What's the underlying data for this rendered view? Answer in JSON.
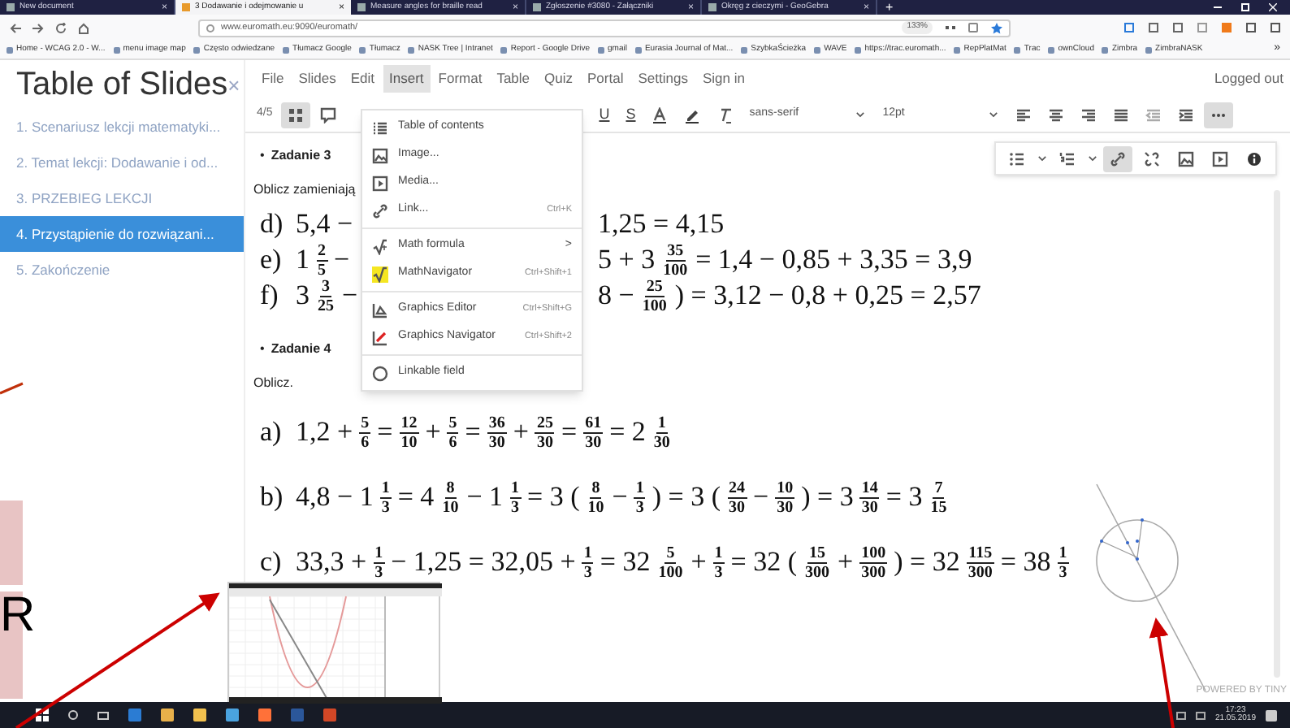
{
  "browser": {
    "tabs": [
      {
        "title": "New document",
        "selected": false,
        "close": "×"
      },
      {
        "title": "3 Dodawanie i odejmowanie u",
        "selected": true,
        "close": "×"
      },
      {
        "title": "Measure angles for braille read",
        "selected": false,
        "close": "×"
      },
      {
        "title": "Zgłoszenie #3080 - Załączniki",
        "selected": false,
        "close": "×"
      },
      {
        "title": "Okręg z cieczymi - GeoGebra",
        "selected": false,
        "close": "×"
      }
    ],
    "new_tab": "+",
    "url": "www.euromath.eu:9090/euromath/",
    "zoom": "133%",
    "bookmarks": [
      "Home - WCAG 2.0 - W...",
      "menu image map",
      "Często odwiedzane",
      "Tłumacz Google",
      "Tłumacz",
      "NASK Tree | Intranet",
      "Report - Google Drive",
      "gmail",
      "Eurasia Journal of Mat...",
      "SzybkaŚcieżka",
      "WAVE",
      "https://trac.euromath...",
      "RepPlatMat",
      "Trac",
      "ownCloud",
      "Zimbra",
      "ZimbraNASK"
    ],
    "more": "»"
  },
  "sidebar": {
    "title": "Table of Slides",
    "close": "×",
    "slides": [
      {
        "label": "1. Scenariusz lekcji matematyki...",
        "selected": false
      },
      {
        "label": "2. Temat lekcji: Dodawanie i od...",
        "selected": false
      },
      {
        "label": "3. PRZEBIEG LEKCJI",
        "selected": false
      },
      {
        "label": "4.  Przystąpienie do rozwiązani...",
        "selected": true
      },
      {
        "label": "5. Zakończenie",
        "selected": false
      }
    ]
  },
  "menu": [
    {
      "label": "File",
      "selected": false
    },
    {
      "label": "Slides",
      "selected": false
    },
    {
      "label": "Edit",
      "selected": false
    },
    {
      "label": "Insert",
      "selected": true
    },
    {
      "label": "Format",
      "selected": false
    },
    {
      "label": "Table",
      "selected": false
    },
    {
      "label": "Quiz",
      "selected": false
    },
    {
      "label": "Portal",
      "selected": false
    },
    {
      "label": "Settings",
      "selected": false
    },
    {
      "label": "Sign in",
      "selected": false
    }
  ],
  "login_status": "Logged out",
  "toolbar": {
    "page": "4/5",
    "font": "sans-serif",
    "size": "12pt",
    "buttons": [
      {
        "kind": "grid",
        "pressed": true
      },
      {
        "kind": "comment",
        "pressed": false
      },
      {
        "kind": "gap"
      },
      {
        "kind": "glyph",
        "text": "U",
        "pressed": false
      },
      {
        "kind": "glyph",
        "text": "S",
        "pressed": false
      },
      {
        "kind": "textcolor",
        "pressed": false
      },
      {
        "kind": "highlight",
        "pressed": false
      },
      {
        "kind": "clear",
        "pressed": false
      },
      {
        "kind": "selects"
      },
      {
        "kind": "align-left",
        "pressed": false
      },
      {
        "kind": "align-center",
        "pressed": false
      },
      {
        "kind": "align-right",
        "pressed": false
      },
      {
        "kind": "justify",
        "pressed": false
      },
      {
        "kind": "outdent",
        "pressed": false
      },
      {
        "kind": "indent",
        "pressed": false
      },
      {
        "kind": "more",
        "pressed": true
      }
    ]
  },
  "more_toolbar": [
    {
      "kind": "bullets",
      "pressed": false
    },
    {
      "kind": "numbers",
      "pressed": false
    },
    {
      "kind": "link",
      "pressed": true
    },
    {
      "kind": "unlink",
      "pressed": false
    },
    {
      "kind": "image",
      "pressed": false
    },
    {
      "kind": "media",
      "pressed": false
    },
    {
      "kind": "info",
      "pressed": false
    }
  ],
  "insert_menu": [
    {
      "kind": "item",
      "label": "Table of contents"
    },
    {
      "kind": "item",
      "label": "Image..."
    },
    {
      "kind": "item",
      "label": "Media..."
    },
    {
      "kind": "item",
      "label": "Link...",
      "shortcut": "Ctrl+K"
    },
    {
      "kind": "separator"
    },
    {
      "kind": "item",
      "label": "Math formula",
      "submenu": ">"
    },
    {
      "kind": "item",
      "label": "MathNavigator",
      "shortcut": "Ctrl+Shift+1"
    },
    {
      "kind": "separator"
    },
    {
      "kind": "item",
      "label": "Graphics Editor",
      "shortcut": "Ctrl+Shift+G"
    },
    {
      "kind": "item",
      "label": "Graphics Navigator",
      "shortcut": "Ctrl+Shift+2"
    },
    {
      "kind": "separator"
    },
    {
      "kind": "item",
      "label": "Linkable field"
    }
  ],
  "content": [
    {
      "kind": "bullet",
      "marker": "•",
      "text": "Zadanie 3"
    },
    {
      "kind": "para",
      "text": "Oblicz zamieniają"
    },
    {
      "kind": "formula",
      "label": "d)",
      "segments": [
        [
          "5,4 −"
        ],
        [
          "1,25 = 4,15"
        ]
      ]
    },
    {
      "kind": "formula",
      "label": "e)",
      "segments": [
        [
          "1",
          {
            "n": "2",
            "d": "5"
          },
          "−"
        ],
        [
          "5 + 3",
          {
            "n": "35",
            "d": "100"
          },
          "= 1,4 − 0,85 + 3,35 = 3,9"
        ]
      ]
    },
    {
      "kind": "formula",
      "label": "f)",
      "segments": [
        [
          "3",
          {
            "n": "3",
            "d": "25"
          },
          "−"
        ],
        [
          "8 −",
          {
            "n": "25",
            "d": "100"
          },
          ") = 3,12 − 0,8 + 0,25 = 2,57"
        ]
      ]
    },
    {
      "kind": "bullet",
      "marker": "•",
      "text": "Zadanie 4"
    },
    {
      "kind": "para",
      "text": "Oblicz."
    },
    {
      "kind": "formula",
      "label": "a)",
      "segments": [
        [
          "1,2 +",
          {
            "n": "5",
            "d": "6"
          },
          "=",
          {
            "n": "12",
            "d": "10"
          },
          "+",
          {
            "n": "5",
            "d": "6"
          },
          "=",
          {
            "n": "36",
            "d": "30"
          },
          "+",
          {
            "n": "25",
            "d": "30"
          },
          "=",
          {
            "n": "61",
            "d": "30"
          },
          "= 2",
          {
            "n": "1",
            "d": "30"
          }
        ]
      ]
    },
    {
      "kind": "formula",
      "label": "b)",
      "segments": [
        [
          "4,8 − 1",
          {
            "n": "1",
            "d": "3"
          },
          "= 4",
          {
            "n": "8",
            "d": "10"
          },
          "− 1",
          {
            "n": "1",
            "d": "3"
          },
          "= 3 (",
          {
            "n": "8",
            "d": "10"
          },
          "−",
          {
            "n": "1",
            "d": "3"
          },
          ") = 3 (",
          {
            "n": "24",
            "d": "30"
          },
          "−",
          {
            "n": "10",
            "d": "30"
          },
          ") = 3",
          {
            "n": "14",
            "d": "30"
          },
          "= 3",
          {
            "n": "7",
            "d": "15"
          }
        ]
      ]
    },
    {
      "kind": "formula",
      "label": "c)",
      "segments": [
        [
          "33,3 +",
          {
            "n": "1",
            "d": "3"
          },
          "− 1,25 = 32,05 +",
          {
            "n": "1",
            "d": "3"
          },
          "= 32",
          {
            "n": "5",
            "d": "100"
          },
          "+",
          {
            "n": "1",
            "d": "3"
          },
          "= 32 (",
          {
            "n": "15",
            "d": "300"
          },
          "+",
          {
            "n": "100",
            "d": "300"
          },
          ") = 32",
          {
            "n": "115",
            "d": "300"
          },
          "= 38",
          {
            "n": "1",
            "d": "3"
          }
        ]
      ]
    }
  ],
  "overlay": {
    "letter": "R",
    "credit": "POWERED BY TINY"
  },
  "taskbar": {
    "apps": [
      {
        "color": "#2b7cd3"
      },
      {
        "color": "#e8b04a"
      },
      {
        "color": "#f2c14e"
      },
      {
        "color": "#4aa3df"
      },
      {
        "color": "#ff7139"
      },
      {
        "color": "#2b579a"
      },
      {
        "color": "#d24726"
      }
    ],
    "time": "17:23",
    "date": "21.05.2019"
  }
}
